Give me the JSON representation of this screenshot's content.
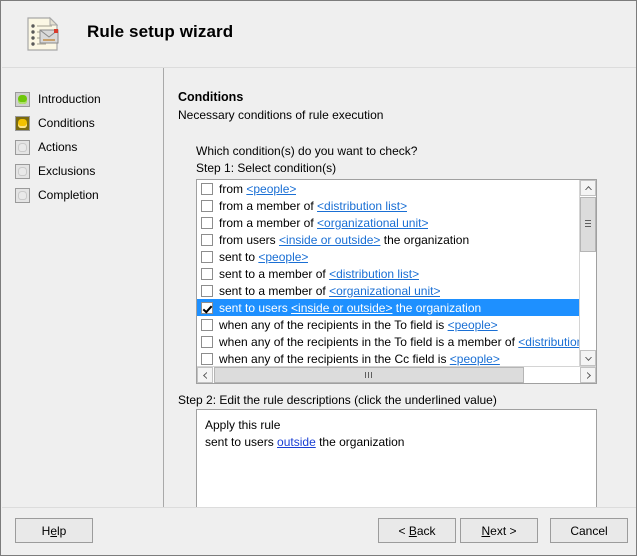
{
  "window": {
    "title": "Rule setup wizard",
    "icon": "rule-document-envelope-icon"
  },
  "sidebar": {
    "items": [
      {
        "label": "Introduction",
        "state": "done",
        "icon": "status-square-green-icon"
      },
      {
        "label": "Conditions",
        "state": "active",
        "icon": "status-square-amber-icon"
      },
      {
        "label": "Actions",
        "state": "todo",
        "icon": "status-square-gray-icon"
      },
      {
        "label": "Exclusions",
        "state": "todo",
        "icon": "status-square-gray-icon"
      },
      {
        "label": "Completion",
        "state": "todo",
        "icon": "status-square-gray-icon"
      }
    ]
  },
  "main": {
    "heading": "Conditions",
    "subheading": "Necessary conditions of rule execution",
    "question": "Which condition(s) do you want to check?",
    "step1_label": "Step 1: Select condition(s)",
    "step2_label": "Step 2: Edit the rule descriptions (click the underlined value)",
    "conditions": [
      {
        "checked": false,
        "selected": false,
        "parts": [
          {
            "t": "from ",
            "link": false
          },
          {
            "t": "<people>",
            "link": true
          }
        ]
      },
      {
        "checked": false,
        "selected": false,
        "parts": [
          {
            "t": "from a member of ",
            "link": false
          },
          {
            "t": "<distribution list>",
            "link": true
          }
        ]
      },
      {
        "checked": false,
        "selected": false,
        "parts": [
          {
            "t": "from a member of ",
            "link": false
          },
          {
            "t": "<organizational unit>",
            "link": true
          }
        ]
      },
      {
        "checked": false,
        "selected": false,
        "parts": [
          {
            "t": "from users ",
            "link": false
          },
          {
            "t": "<inside or outside>",
            "link": true
          },
          {
            "t": " the organization",
            "link": false
          }
        ]
      },
      {
        "checked": false,
        "selected": false,
        "parts": [
          {
            "t": "sent to ",
            "link": false
          },
          {
            "t": "<people>",
            "link": true
          }
        ]
      },
      {
        "checked": false,
        "selected": false,
        "parts": [
          {
            "t": "sent to a member of ",
            "link": false
          },
          {
            "t": "<distribution list>",
            "link": true
          }
        ]
      },
      {
        "checked": false,
        "selected": false,
        "parts": [
          {
            "t": "sent to a member of ",
            "link": false
          },
          {
            "t": "<organizational unit>",
            "link": true
          }
        ]
      },
      {
        "checked": true,
        "selected": true,
        "parts": [
          {
            "t": "sent to users ",
            "link": false
          },
          {
            "t": "<inside or outside>",
            "link": true
          },
          {
            "t": " the organization",
            "link": false
          }
        ]
      },
      {
        "checked": false,
        "selected": false,
        "parts": [
          {
            "t": "when any of the recipients in the To field is ",
            "link": false
          },
          {
            "t": "<people>",
            "link": true
          }
        ]
      },
      {
        "checked": false,
        "selected": false,
        "parts": [
          {
            "t": "when any of the recipients in the To field is a member of ",
            "link": false
          },
          {
            "t": "<distribution list>",
            "link": true
          }
        ]
      },
      {
        "checked": false,
        "selected": false,
        "parts": [
          {
            "t": "when any of the recipients in the Cc field is ",
            "link": false
          },
          {
            "t": "<people>",
            "link": true
          }
        ]
      }
    ],
    "description": {
      "line1": "Apply this rule",
      "line2_prefix": "sent to users ",
      "line2_link": "outside",
      "line2_suffix": " the organization"
    },
    "scrollbars": {
      "up_arrow": "▲",
      "down_arrow": "▼",
      "left_arrow": "◀",
      "right_arrow": "▶"
    }
  },
  "footer": {
    "help": {
      "pre": "H",
      "acc": "e",
      "post": "lp"
    },
    "back": {
      "pre": "< ",
      "acc": "B",
      "post": "ack"
    },
    "next": {
      "pre": "",
      "acc": "N",
      "post": "ext >"
    },
    "cancel": {
      "pre": "Cancel",
      "acc": "",
      "post": ""
    }
  },
  "colors": {
    "selection": "#1e90ff",
    "link": "#1a6fd4",
    "window_bg": "#efefef",
    "active_step": "#f2c100",
    "done_step": "#6ec70b"
  }
}
